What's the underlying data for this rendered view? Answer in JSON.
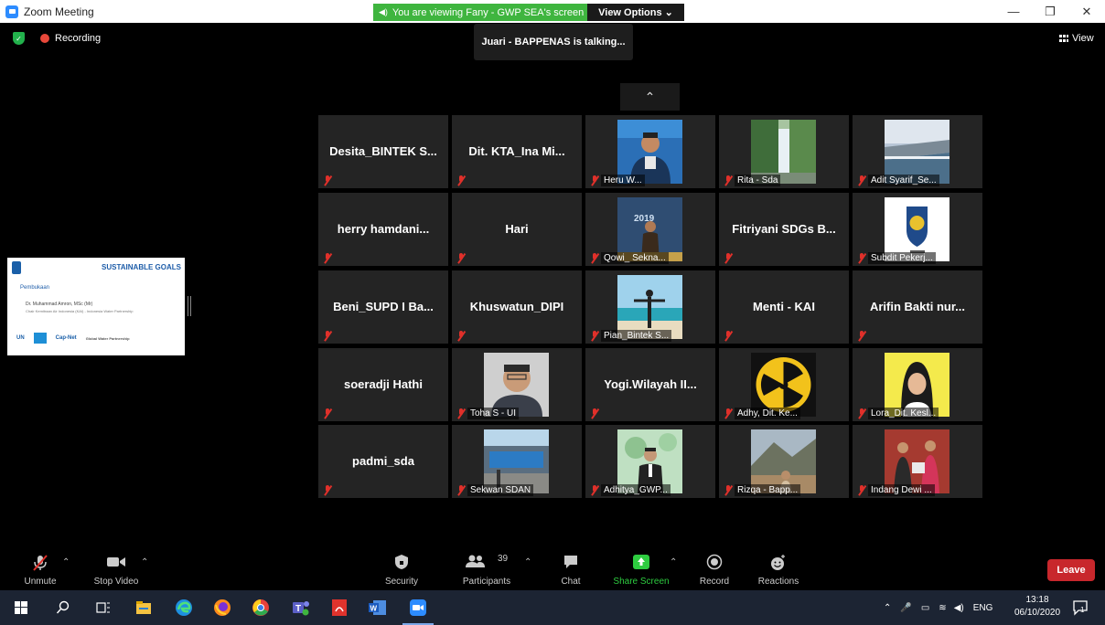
{
  "window": {
    "title": "Zoom Meeting"
  },
  "share_banner": {
    "text": "You are viewing Fany - GWP SEA's screen",
    "view_options": "View Options ⌄"
  },
  "recording": {
    "label": "Recording"
  },
  "talking": {
    "text": "Juari - BAPPENAS is talking..."
  },
  "view_button": {
    "label": "View"
  },
  "shared_screen": {
    "title": "SUSTAINABLE GOALS",
    "heading": "Pembukaan",
    "speaker": "Dr. Muhammad Amron, MSc (Mr)",
    "speaker_role": "Chair Kemitraan Air Indonesia (KAI) - Indonesia Water Partnership",
    "logo_un": "UN",
    "logo_capnet": "Cap-Net",
    "logo_gwp": "Global Water Partnership"
  },
  "participants": [
    {
      "name": "Desita_BINTEK S...",
      "video": false
    },
    {
      "name": "Dit. KTA_Ina Mi...",
      "video": false
    },
    {
      "name": "Heru W...",
      "video": true,
      "scene": "person-blue"
    },
    {
      "name": "Rita - Sda",
      "video": true,
      "scene": "waterfall"
    },
    {
      "name": "Adit Syarif_Se...",
      "video": true,
      "scene": "dam"
    },
    {
      "name": "herry hamdani...",
      "video": false
    },
    {
      "name": "Hari",
      "video": false
    },
    {
      "name": "Qowi_ Sekna...",
      "video": true,
      "scene": "person-stage"
    },
    {
      "name": "Fitriyani SDGs B...",
      "video": false
    },
    {
      "name": "Subdit Pekerj...",
      "video": true,
      "scene": "emblem"
    },
    {
      "name": "Beni_SUPD I Ba...",
      "video": false
    },
    {
      "name": "Khuswatun_DIPI",
      "video": false
    },
    {
      "name": "Pian_Bintek S...",
      "video": true,
      "scene": "beach"
    },
    {
      "name": "Menti - KAI",
      "video": false
    },
    {
      "name": "Arifin Bakti nur...",
      "video": false
    },
    {
      "name": "soeradji Hathi",
      "video": false
    },
    {
      "name": "Toha S - UI",
      "video": true,
      "scene": "portrait-man"
    },
    {
      "name": "Yogi.Wilayah II...",
      "video": false
    },
    {
      "name": "Adhy, Dit. Ke...",
      "video": true,
      "scene": "radiation"
    },
    {
      "name": "Lora_Dit. Kesl...",
      "video": true,
      "scene": "hijab"
    },
    {
      "name": "padmi_sda",
      "video": false
    },
    {
      "name": "Sekwan SDAN",
      "video": true,
      "scene": "building"
    },
    {
      "name": "Adhitya_GWP...",
      "video": true,
      "scene": "suit"
    },
    {
      "name": "Rizqa - Bapp...",
      "video": true,
      "scene": "mountain"
    },
    {
      "name": "Indang Dewi ...",
      "video": true,
      "scene": "group"
    }
  ],
  "toolbar": {
    "unmute": "Unmute",
    "stop_video": "Stop Video",
    "security": "Security",
    "participants": "Participants",
    "participants_count": "39",
    "chat": "Chat",
    "share_screen": "Share Screen",
    "record": "Record",
    "reactions": "Reactions",
    "leave": "Leave"
  },
  "taskbar": {
    "language": "ENG",
    "time": "13:18",
    "date": "06/10/2020",
    "notifications": "1"
  },
  "colors": {
    "share_green": "#3fb53f",
    "leave_red": "#c8272c",
    "mute_red": "#e0302a",
    "tile_bg": "#242424"
  }
}
